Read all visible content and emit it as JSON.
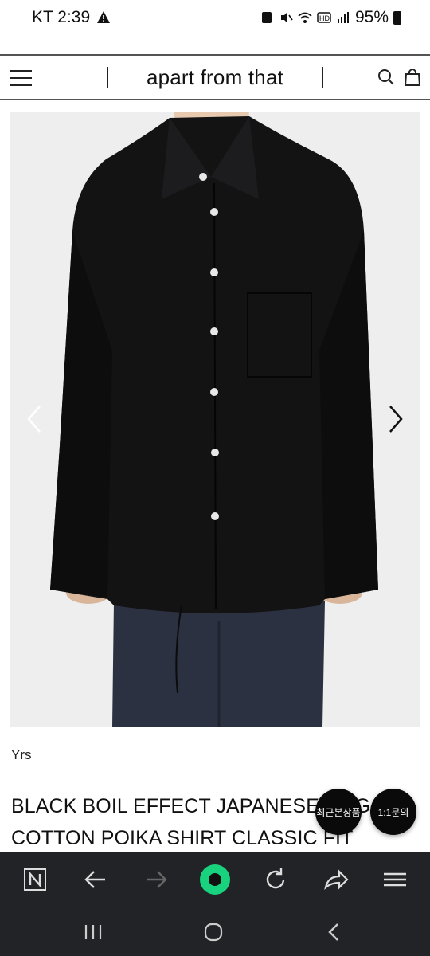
{
  "status_bar": {
    "carrier_time": "KT 2:39",
    "battery": "95%"
  },
  "header": {
    "brand": "apart from that"
  },
  "product": {
    "brand": "Yrs",
    "title": "BLACK BOIL EFFECT JAPANESE DOG COTTON POIKA SHIRT CLASSIC FIT"
  },
  "floating": {
    "recent_label": "최근본상품",
    "inquiry_label": "1:1문의"
  },
  "colors": {
    "accent_green": "#19d27d",
    "browser_bar": "#222326"
  }
}
